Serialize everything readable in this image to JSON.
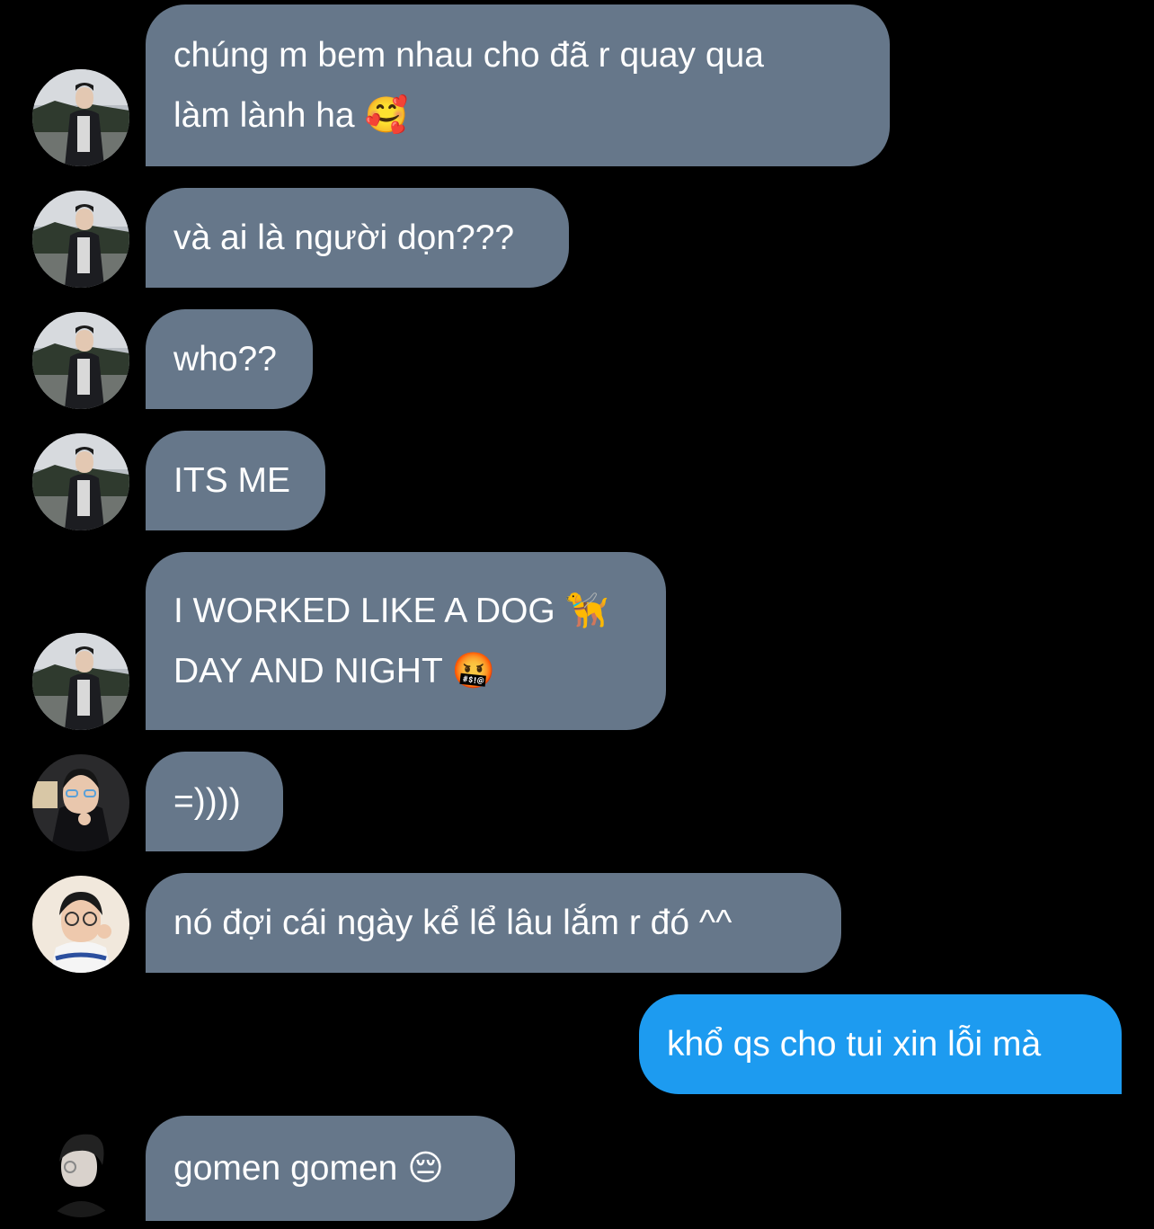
{
  "colors": {
    "background": "#000000",
    "incoming_bubble": "#66778a",
    "outgoing_bubble": "#1d9bf0",
    "text": "#ffffff"
  },
  "messages": [
    {
      "sender": "user1",
      "direction": "incoming",
      "text": "chúng m bem nhau cho đã r quay qua\nlàm lành ha 🥰"
    },
    {
      "sender": "user1",
      "direction": "incoming",
      "text": "và ai là người dọn???"
    },
    {
      "sender": "user1",
      "direction": "incoming",
      "text": "who??"
    },
    {
      "sender": "user1",
      "direction": "incoming",
      "text": "ITS ME"
    },
    {
      "sender": "user1",
      "direction": "incoming",
      "text": "I WORKED LIKE A DOG 🦮\nDAY AND NIGHT 🤬"
    },
    {
      "sender": "user2",
      "direction": "incoming",
      "text": "=))))"
    },
    {
      "sender": "user3",
      "direction": "incoming",
      "text": "nó đợi cái ngày kể lể lâu lắm r đó ^^"
    },
    {
      "sender": "me",
      "direction": "outgoing",
      "text": "khổ qs cho tui xin lỗi mà"
    },
    {
      "sender": "user4",
      "direction": "incoming",
      "text": "gomen gomen 😔"
    }
  ]
}
